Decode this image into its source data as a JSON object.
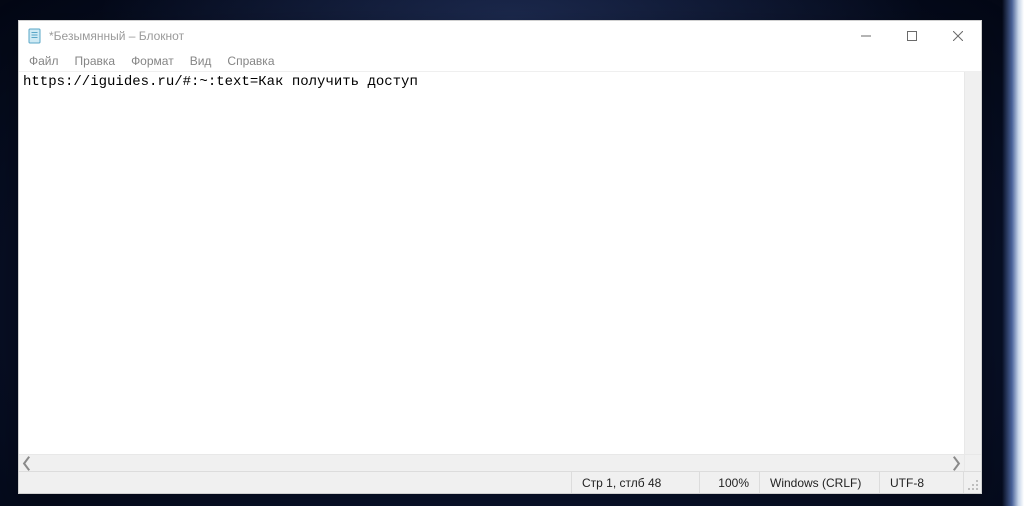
{
  "window": {
    "title": "*Безымянный – Блокнот"
  },
  "menubar": {
    "items": [
      "Файл",
      "Правка",
      "Формат",
      "Вид",
      "Справка"
    ]
  },
  "editor": {
    "content": "https://iguides.ru/#:~:text=Как получить доступ"
  },
  "statusbar": {
    "position": "Стр 1, стлб 48",
    "zoom": "100%",
    "line_ending": "Windows (CRLF)",
    "encoding": "UTF-8"
  },
  "icons": {
    "app": "notepad-icon",
    "minimize": "minimize-icon",
    "maximize": "maximize-icon",
    "close": "close-icon",
    "resize_grip": "resize-grip-icon",
    "scroll_left": "chevron-left-icon",
    "scroll_right": "chevron-right-icon"
  }
}
